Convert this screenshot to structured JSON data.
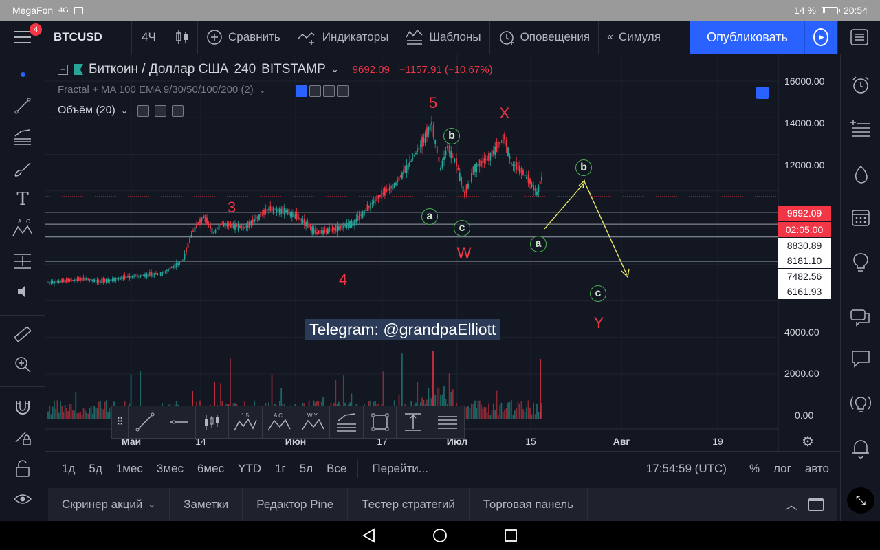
{
  "status_bar": {
    "carrier": "MegaFon",
    "network": "4G",
    "battery": "14 %",
    "battery_level": 0.14,
    "time": "20:54"
  },
  "toolbar": {
    "menu_badge": "4",
    "symbol": "BTCUSD",
    "interval": "4Ч",
    "compare": "Сравнить",
    "indicators": "Индикаторы",
    "templates": "Шаблоны",
    "alerts": "Оповещения",
    "simulator": "Симуля",
    "publish": "Опубликовать"
  },
  "legend": {
    "title": "Биткоин / Доллар США",
    "interval": "240",
    "exchange": "BITSTAMP",
    "last": "9692.09",
    "change": "−1157.91 (−10.67%)",
    "indicator": "Fractal + MA 100 EMA 9/30/50/100/200 (2)",
    "volume": "Объём (20)"
  },
  "price_axis": {
    "labels": [
      "16000.00",
      "14000.00",
      "12000.00",
      "4000.00",
      "2000.00",
      "0.00"
    ],
    "tags": {
      "current": "9692.09",
      "countdown": "02:05:00",
      "l1": "8830.89",
      "l2": "8181.10",
      "l3": "7482.56",
      "l4": "6161.93"
    }
  },
  "time_axis": {
    "labels": [
      "Май",
      "14",
      "Июн",
      "17",
      "Июл",
      "15",
      "Авг",
      "19"
    ]
  },
  "annotations": {
    "wave_3": "3",
    "wave_4": "4",
    "wave_5": "5",
    "wave_x": "X",
    "wave_w": "W",
    "wave_y": "Y",
    "circ_a1": "a",
    "circ_b1": "b",
    "circ_c1": "c",
    "circ_b2": "b",
    "circ_a2": "a",
    "circ_c2": "c",
    "telegram": "Telegram: @grandpaElliott"
  },
  "drawing_toolbar": {
    "wave1_top": "1 5",
    "wave2_top": "A C",
    "wave3_top": "W Y"
  },
  "range_bar": {
    "ranges": [
      "1д",
      "5д",
      "1мес",
      "3мес",
      "6мес",
      "YTD",
      "1г",
      "5л",
      "Все"
    ],
    "goto": "Перейти...",
    "clock": "17:54:59 (UTC)",
    "percent": "%",
    "log": "лог",
    "auto": "авто"
  },
  "bottom_tabs": [
    "Скринер акций",
    "Заметки",
    "Редактор Pine",
    "Тестер стратегий",
    "Торговая панель"
  ],
  "colors": {
    "accent": "#2962ff",
    "down": "#f23645",
    "up": "#26a69a",
    "projection": "#f5f26a",
    "circle": "#4caf50"
  }
}
